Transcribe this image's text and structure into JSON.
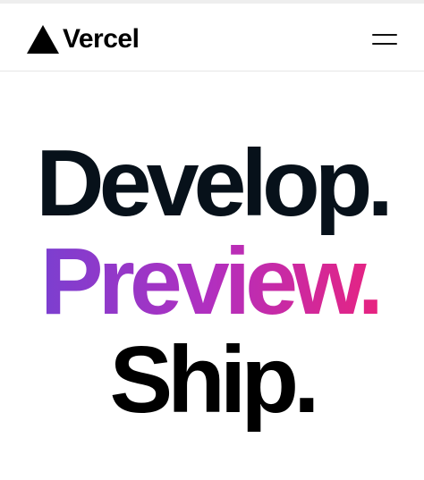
{
  "header": {
    "logo_icon": "vercel-triangle-icon",
    "logo_text": "Vercel",
    "menu_icon": "hamburger-menu-icon"
  },
  "hero": {
    "line1": "Develop.",
    "line2": "Preview.",
    "line3": "Ship."
  },
  "colors": {
    "develop": "#07111a",
    "preview_gradient_start": "#7b3fd0",
    "preview_gradient_end": "#e8237f",
    "ship": "#000000"
  }
}
